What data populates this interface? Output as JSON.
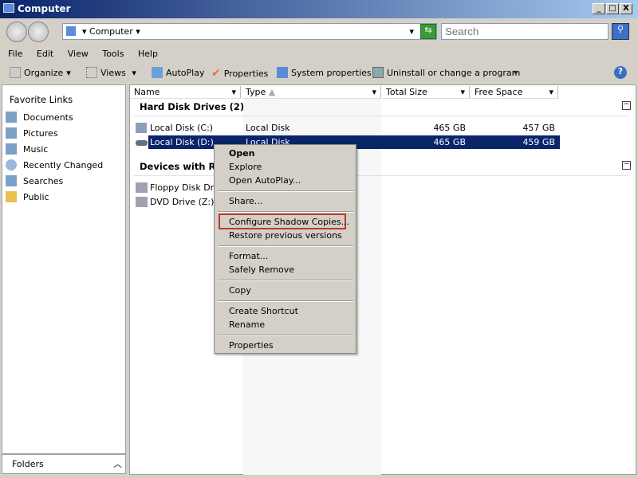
{
  "window": {
    "title": "Computer"
  },
  "address": {
    "location": "Computer",
    "search_placeholder": "Search"
  },
  "menu": [
    "File",
    "Edit",
    "View",
    "Tools",
    "Help"
  ],
  "toolbar": {
    "organize": "Organize",
    "views": "Views",
    "autoplay": "AutoPlay",
    "properties": "Properties",
    "system_properties": "System properties",
    "uninstall": "Uninstall or change a program",
    "more": "»"
  },
  "sidebar": {
    "title": "Favorite Links",
    "items": [
      "Documents",
      "Pictures",
      "Music",
      "Recently Changed",
      "Searches",
      "Public"
    ],
    "folders": "Folders"
  },
  "columns": [
    "Name",
    "Type",
    "Total Size",
    "Free Space"
  ],
  "groups": [
    {
      "title": "Hard Disk Drives (2)",
      "items": [
        {
          "name": "Local Disk (C:)",
          "type": "Local Disk",
          "total": "465 GB",
          "free": "457 GB"
        },
        {
          "name": "Local Disk (D:)",
          "type": "Local Disk",
          "total": "465 GB",
          "free": "459 GB"
        }
      ]
    },
    {
      "title": "Devices with Removable Storage (2)",
      "items": [
        {
          "name": "Floppy Disk Drive (A:)"
        },
        {
          "name": "DVD Drive (Z:)"
        }
      ]
    }
  ],
  "context_menu": [
    "Open",
    "Explore",
    "Open AutoPlay...",
    "Share...",
    "Configure Shadow Copies...",
    "Restore previous versions",
    "Format...",
    "Safely Remove",
    "Copy",
    "Create Shortcut",
    "Rename",
    "Properties"
  ],
  "colors": {
    "selection": "#0a246a",
    "highlight_border": "#c0392b"
  }
}
